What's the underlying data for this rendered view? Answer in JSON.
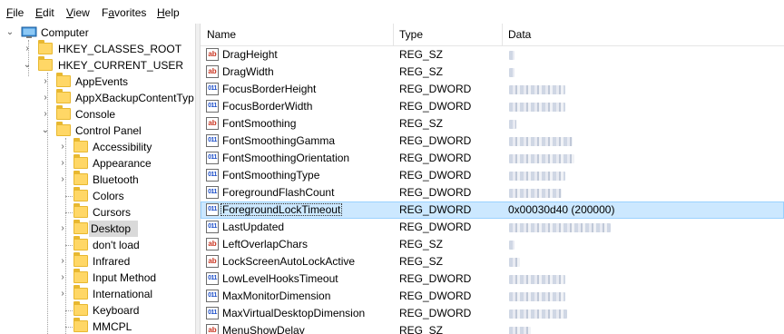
{
  "menubar": {
    "items": [
      {
        "label": "File",
        "accel": "F",
        "rest": "ile"
      },
      {
        "label": "Edit",
        "accel": "E",
        "rest": "dit"
      },
      {
        "label": "View",
        "accel": "V",
        "rest": "iew"
      },
      {
        "label": "Favorites",
        "accel": "a",
        "pre": "F",
        "rest": "vorites"
      },
      {
        "label": "Help",
        "accel": "H",
        "rest": "elp"
      }
    ]
  },
  "tree": {
    "root": "Computer",
    "hives": [
      "HKEY_CLASSES_ROOT",
      "HKEY_CURRENT_USER"
    ],
    "user_keys": [
      "AppEvents",
      "AppXBackupContentTyp",
      "Console",
      "Control Panel"
    ],
    "control_panel_keys": [
      "Accessibility",
      "Appearance",
      "Bluetooth",
      "Colors",
      "Cursors",
      "Desktop",
      "don't load",
      "Infrared",
      "Input Method",
      "International",
      "Keyboard",
      "MMCPL"
    ],
    "selected": "Desktop"
  },
  "columns": {
    "name": "Name",
    "type": "Type",
    "data": "Data"
  },
  "values": [
    {
      "name": "DragHeight",
      "type": "REG_SZ",
      "data": ""
    },
    {
      "name": "DragWidth",
      "type": "REG_SZ",
      "data": ""
    },
    {
      "name": "FocusBorderHeight",
      "type": "REG_DWORD",
      "data": ""
    },
    {
      "name": "FocusBorderWidth",
      "type": "REG_DWORD",
      "data": ""
    },
    {
      "name": "FontSmoothing",
      "type": "REG_SZ",
      "data": ""
    },
    {
      "name": "FontSmoothingGamma",
      "type": "REG_DWORD",
      "data": ""
    },
    {
      "name": "FontSmoothingOrientation",
      "type": "REG_DWORD",
      "data": ""
    },
    {
      "name": "FontSmoothingType",
      "type": "REG_DWORD",
      "data": ""
    },
    {
      "name": "ForegroundFlashCount",
      "type": "REG_DWORD",
      "data": ""
    },
    {
      "name": "ForegroundLockTimeout",
      "type": "REG_DWORD",
      "data": "0x00030d40 (200000)"
    },
    {
      "name": "LastUpdated",
      "type": "REG_DWORD",
      "data": ""
    },
    {
      "name": "LeftOverlapChars",
      "type": "REG_SZ",
      "data": ""
    },
    {
      "name": "LockScreenAutoLockActive",
      "type": "REG_SZ",
      "data": ""
    },
    {
      "name": "LowLevelHooksTimeout",
      "type": "REG_DWORD",
      "data": ""
    },
    {
      "name": "MaxMonitorDimension",
      "type": "REG_DWORD",
      "data": ""
    },
    {
      "name": "MaxVirtualDesktopDimension",
      "type": "REG_DWORD",
      "data": ""
    },
    {
      "name": "MenuShowDelay",
      "type": "REG_SZ",
      "data": ""
    }
  ],
  "selected_value": "ForegroundLockTimeout",
  "colors": {
    "selection": "#cce8ff",
    "selection_border": "#99d1ff",
    "tree_selection": "#d9d9d9",
    "folder": "#ffd766"
  }
}
